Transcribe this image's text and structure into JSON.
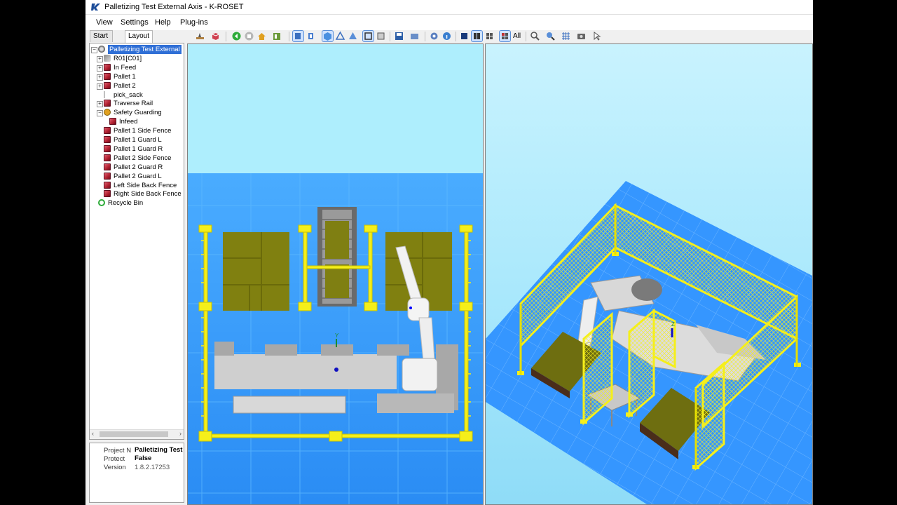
{
  "window": {
    "title": "Palletizing Test External Axis - K-ROSET"
  },
  "menu": [
    "View",
    "Settings",
    "Help",
    "Plug-ins"
  ],
  "tabs": [
    "Start Page",
    "Layout"
  ],
  "tree": [
    {
      "label": "Palletizing Test External",
      "level": 0,
      "expander": "minus",
      "icon": "workcell-icon",
      "selected": true
    },
    {
      "label": "R01[C01]",
      "level": 1,
      "expander": "plus",
      "icon": "robot-icon"
    },
    {
      "label": "In Feed",
      "level": 1,
      "expander": "plus",
      "icon": "cube-icon"
    },
    {
      "label": "Pallet 1",
      "level": 1,
      "expander": "plus",
      "icon": "cube-icon"
    },
    {
      "label": "Pallet 2",
      "level": 1,
      "expander": "plus",
      "icon": "cube-icon"
    },
    {
      "label": "pick_sack",
      "level": 1,
      "expander": "none",
      "icon": "tool-icon"
    },
    {
      "label": "Traverse Rail",
      "level": 1,
      "expander": "plus",
      "icon": "cube-icon"
    },
    {
      "label": "Safety Guarding",
      "level": 1,
      "expander": "minus",
      "icon": "group-icon"
    },
    {
      "label": "Infeed",
      "level": 2,
      "expander": "none",
      "icon": "cube-icon"
    },
    {
      "label": "Pallet 1 Side Fence",
      "level": 1,
      "expander": "none",
      "icon": "cube-icon"
    },
    {
      "label": "Pallet 1 Guard L",
      "level": 1,
      "expander": "none",
      "icon": "cube-icon"
    },
    {
      "label": "Pallet 1 Guard R",
      "level": 1,
      "expander": "none",
      "icon": "cube-icon"
    },
    {
      "label": "Pallet 2 Side Fence",
      "level": 1,
      "expander": "none",
      "icon": "cube-icon"
    },
    {
      "label": "Pallet 2 Guard R",
      "level": 1,
      "expander": "none",
      "icon": "cube-icon"
    },
    {
      "label": "Pallet 2 Guard L",
      "level": 1,
      "expander": "none",
      "icon": "cube-icon"
    },
    {
      "label": "Left Side Back Fence",
      "level": 1,
      "expander": "none",
      "icon": "cube-icon"
    },
    {
      "label": "Right Side Back Fence",
      "level": 1,
      "expander": "none",
      "icon": "cube-icon"
    },
    {
      "label": "Recycle Bin",
      "level": 0,
      "expander": "none",
      "icon": "recycle-icon"
    }
  ],
  "properties": [
    {
      "key": "Project N",
      "value": "Palletizing Test"
    },
    {
      "key": "Protect",
      "value": "False"
    },
    {
      "key": "Version",
      "value": "1.8.2.17253"
    }
  ],
  "toolbar": {
    "all_label": "All"
  },
  "viewport_top": {
    "axis_label": "Y"
  },
  "viewport_iso": {
    "axis_label": "Z"
  },
  "colors": {
    "fence": "#f5ef1a",
    "pallet": "#808010",
    "floor": "#3aa0ff",
    "sky": "#aeeefd",
    "machine": "#d8d8d8",
    "selection": "#2f6fd6"
  }
}
